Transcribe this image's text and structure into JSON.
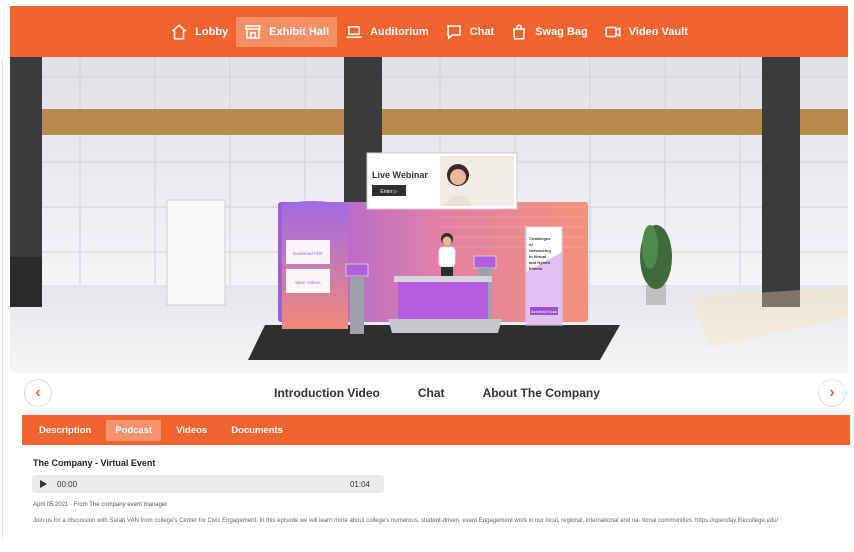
{
  "nav": {
    "items": [
      {
        "label": "Lobby",
        "icon": "home-icon",
        "active": false
      },
      {
        "label": "Exhibit Hall",
        "icon": "storefront-icon",
        "active": true
      },
      {
        "label": "Auditorium",
        "icon": "laptop-icon",
        "active": false
      },
      {
        "label": "Chat",
        "icon": "chat-bubble-icon",
        "active": false
      },
      {
        "label": "Swag Bag",
        "icon": "shopping-bag-icon",
        "active": false
      },
      {
        "label": "Video Vault",
        "icon": "video-camera-icon",
        "active": false
      }
    ]
  },
  "booth": {
    "webinar_title": "Live Webinar",
    "webinar_button": "Enter ▷",
    "panel_left_1": "Download PDF",
    "panel_left_2": "More Videos",
    "banner_lines": [
      "Challenges",
      "of",
      "Networking",
      "in Virtual",
      "and Hybrid",
      "Events"
    ],
    "banner_button": "Download Ebook"
  },
  "subnav": {
    "prev_label": "‹",
    "next_label": "›",
    "tabs": [
      "Introduction Video",
      "Chat",
      "About The Company"
    ]
  },
  "panel": {
    "tabs": [
      {
        "label": "Description",
        "active": false
      },
      {
        "label": "Podcast",
        "active": true
      },
      {
        "label": "Videos",
        "active": false
      },
      {
        "label": "Documents",
        "active": false
      }
    ],
    "episode_title": "The Company - Virtual Event",
    "player": {
      "current": "00:00",
      "duration": "01:04"
    },
    "meta": "April 05 2021 · From The company event manager",
    "description": "Join us for a discussion with Sarah VAN from college's Center for Civic Engagement. In this episode we will learn more about college's numerous, student-driven, event Engagement work in our local, regional, international and na- tional communities. https://openday.thecollege.edu/"
  },
  "colors": {
    "accent": "#f2642e",
    "booth_purple": "#b35ee0",
    "booth_coral": "#f08a78"
  }
}
